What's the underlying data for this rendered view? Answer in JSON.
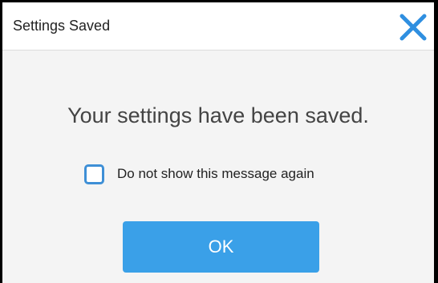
{
  "dialog": {
    "title": "Settings Saved",
    "close_icon": "close-icon",
    "message": "Your settings have been saved.",
    "checkbox": {
      "label": "Do not show this message again",
      "checked": false
    },
    "ok_label": "OK"
  },
  "colors": {
    "accent": "#3aa0e8",
    "checkbox_border": "#3e8fd6",
    "body_background": "#f4f4f4",
    "titlebar_background": "#ffffff"
  }
}
